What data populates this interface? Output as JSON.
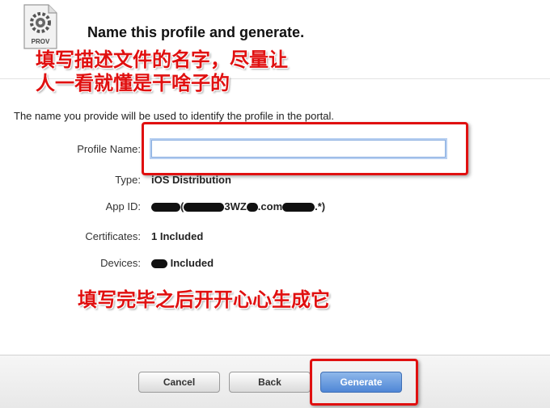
{
  "header": {
    "icon_label": "PROV",
    "title": "Name this profile and generate."
  },
  "annotations": {
    "top_line1": "填写描述文件的名字，尽量让",
    "top_line2": "人一看就懂是干啥子的",
    "bottom": "填写完毕之后开开心心生成它"
  },
  "description": "The name you provide will be used to identify the profile in the portal.",
  "form": {
    "profile_name_label": "Profile Name:",
    "profile_name_value": "",
    "type_label": "Type:",
    "type_value": "iOS Distribution",
    "app_id_label": "App ID:",
    "app_id_visible_middle": "3WZ",
    "app_id_visible_com": ".com",
    "app_id_visible_end": ".*)",
    "certificates_label": "Certificates:",
    "certificates_value": "1 Included",
    "devices_label": "Devices:",
    "devices_value": "Included"
  },
  "buttons": {
    "cancel": "Cancel",
    "back": "Back",
    "generate": "Generate"
  },
  "colors": {
    "annotation_red": "#e01010",
    "primary_button": "#4f86d6"
  }
}
